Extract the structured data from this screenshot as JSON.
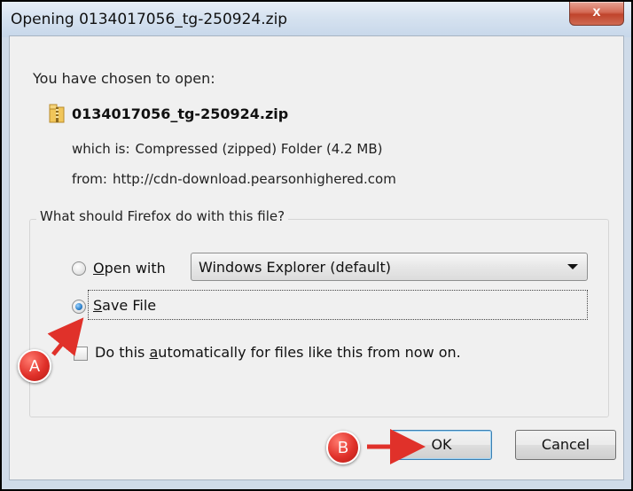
{
  "window": {
    "title": "Opening 0134017056_tg-250924.zip",
    "close_label": "x"
  },
  "dialog": {
    "intro": "You have chosen to open:",
    "file_name": "0134017056_tg-250924.zip",
    "file_icon": "zip-folder-icon",
    "which_is_label": "which is:",
    "which_is_value": "Compressed (zipped) Folder (4.2 MB)",
    "from_label": "from:",
    "from_value": "http://cdn-download.pearsonhighered.com"
  },
  "action_group": {
    "legend": "What should Firefox do with this file?",
    "open_with": {
      "label_prefix": "",
      "label_mnemonic": "O",
      "label_rest": "pen with",
      "checked": false,
      "app_value": "Windows Explorer (default)"
    },
    "save_file": {
      "label_mnemonic": "S",
      "label_rest": "ave File",
      "checked": true
    },
    "auto": {
      "label_prefix": "Do this ",
      "label_mnemonic": "a",
      "label_rest": "utomatically for files like this from now on.",
      "checked": false
    }
  },
  "buttons": {
    "ok": "OK",
    "cancel": "Cancel"
  },
  "annotations": {
    "a": "A",
    "b": "B",
    "color": "#e0312a"
  }
}
